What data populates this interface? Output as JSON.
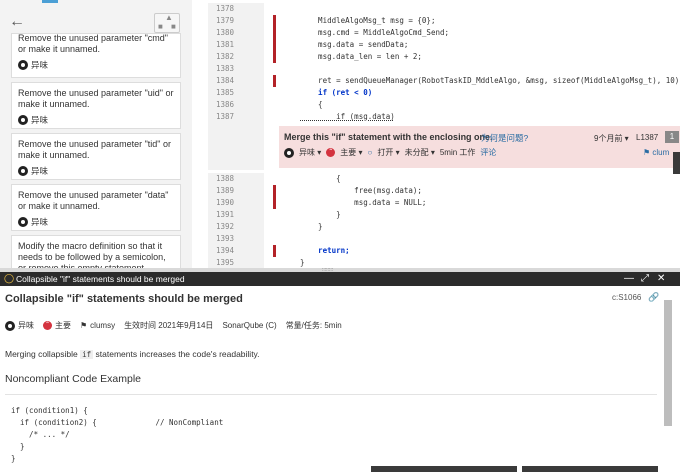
{
  "left_panel": {
    "issues": [
      {
        "message": "Remove the unused parameter \"cmd\" or make it unnamed.",
        "severity": "异味"
      },
      {
        "message": "Remove the unused parameter \"uid\" or make it unnamed.",
        "severity": "异味"
      },
      {
        "message": "Remove the unused parameter \"tid\" or make it unnamed.",
        "severity": "异味"
      },
      {
        "message": "Remove the unused parameter \"data\" or make it unnamed.",
        "severity": "异味"
      },
      {
        "message": "Modify the macro definition so that it needs to be followed by a semicolon, or remove this empty statement.",
        "severity": ""
      }
    ]
  },
  "code_view": {
    "lines_top": [
      {
        "n": "1378",
        "code": "",
        "marked": false
      },
      {
        "n": "1379",
        "code": "    MiddleAlgoMsg_t msg = {0};",
        "marked": true
      },
      {
        "n": "1380",
        "code": "    msg.cmd = MiddleAlgoCmd_Send;",
        "marked": true
      },
      {
        "n": "1381",
        "code": "    msg.data = sendData;",
        "marked": true
      },
      {
        "n": "1382",
        "code": "    msg.data_len = len + 2;",
        "marked": true
      },
      {
        "n": "1383",
        "code": "",
        "marked": false
      },
      {
        "n": "1384",
        "code": "    ret = sendQueueManager(RobotTaskID_MddleAlgo, &msg, sizeof(MiddleAlgoMsg_t), 10);",
        "marked": true
      },
      {
        "n": "1385",
        "code": "    if (ret < 0)",
        "marked": false
      },
      {
        "n": "1386",
        "code": "    {",
        "marked": false
      },
      {
        "n": "1387",
        "code": "        if (msg.data)",
        "marked": false
      }
    ],
    "lines_bottom": [
      {
        "n": "1388",
        "code": "        {",
        "marked": false
      },
      {
        "n": "1389",
        "code": "            free(msg.data);",
        "marked": true
      },
      {
        "n": "1390",
        "code": "            msg.data = NULL;",
        "marked": true
      },
      {
        "n": "1391",
        "code": "        }",
        "marked": false
      },
      {
        "n": "1392",
        "code": "    }",
        "marked": false
      },
      {
        "n": "1393",
        "code": "",
        "marked": false
      },
      {
        "n": "1394",
        "code": "    return;",
        "marked": true
      },
      {
        "n": "1395",
        "code": "}",
        "marked": false
      }
    ],
    "issue": {
      "title": "Merge this \"if\" statement with the enclosing one.",
      "why": "为何是问题?",
      "age": "9个月前 ▾",
      "line": "L1387",
      "count": "1",
      "type": "异味 ▾",
      "severity": "主要 ▾",
      "status": "打开 ▾",
      "assignee": "未分配 ▾",
      "effort": "5min 工作",
      "comment": "评论",
      "tag": "clum"
    }
  },
  "divider_grip": "::::::::",
  "rule_panel": {
    "header_title": "Collapsible \"if\" statements should be merged",
    "title": "Collapsible \"if\" statements should be merged",
    "key": "c:S1066",
    "meta": {
      "type": "异味",
      "severity": "主要",
      "tag": "clumsy",
      "effective": "生效时间 2021年9月14日",
      "repo": "SonarQube (C)",
      "effort": "常量/任务: 5min"
    },
    "desc_before": "Merging collapsible",
    "desc_code": "if",
    "desc_after": "statements increases the code's readability.",
    "section_title": "Noncompliant Code Example",
    "example": "if (condition1) {\n  if (condition2) {             // NonCompliant\n    /* ... */\n  }\n}"
  },
  "icons": {
    "back": "arrow-left-icon",
    "bulb": "lightbulb-icon",
    "link": "link-icon",
    "minimize": "minimize-icon",
    "expand": "expand-icon",
    "close": "close-icon"
  }
}
